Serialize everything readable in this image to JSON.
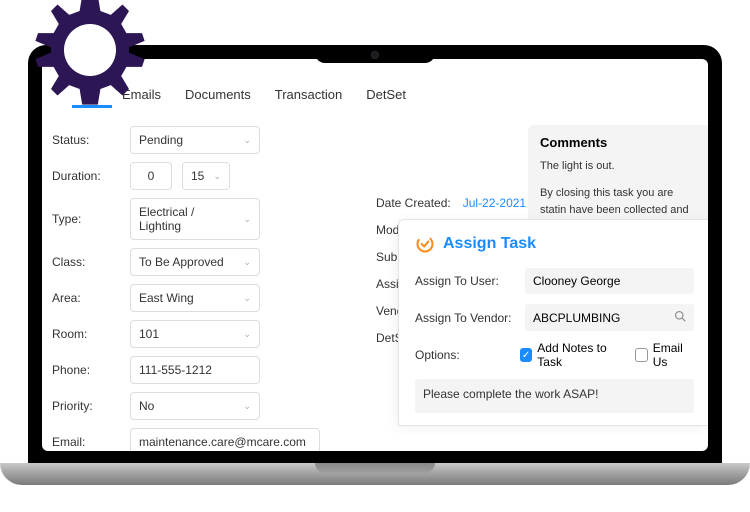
{
  "tabs": [
    "Emails",
    "Documents",
    "Transaction",
    "DetSet"
  ],
  "form": {
    "status": {
      "label": "Status:",
      "value": "Pending"
    },
    "duration": {
      "label": "Duration:",
      "val1": "0",
      "val2": "15"
    },
    "type": {
      "label": "Type:",
      "value": "Electrical / Lighting"
    },
    "class": {
      "label": "Class:",
      "value": "To Be Approved"
    },
    "area": {
      "label": "Area:",
      "value": "East Wing"
    },
    "room": {
      "label": "Room:",
      "value": "101"
    },
    "phone": {
      "label": "Phone:",
      "value": "111-555-1212"
    },
    "priority": {
      "label": "Priority:",
      "value": "No"
    },
    "email": {
      "label": "Email:",
      "value": "maintenance.care@mcare.com"
    }
  },
  "meta": {
    "date_created": {
      "label": "Date Created:",
      "value": "Jul-22-2021"
    },
    "modified": "Modifie",
    "submit": "Submit",
    "assigned": "Assigne",
    "vendor": "Vendo",
    "detset": "DetSet:"
  },
  "comments": {
    "title": "Comments",
    "line1": "The light is out.",
    "line2": "By closing this task you are statin have been collected and accoun up and properly disposed of."
  },
  "modal": {
    "title": "Assign Task",
    "user": {
      "label": "Assign To User:",
      "value": "Clooney George"
    },
    "vendor": {
      "label": "Assign To Vendor:",
      "value": "ABCPLUMBING"
    },
    "options_label": "Options:",
    "opt1": "Add Notes to Task",
    "opt2": "Email Us",
    "notes": "Please complete the work ASAP!"
  }
}
